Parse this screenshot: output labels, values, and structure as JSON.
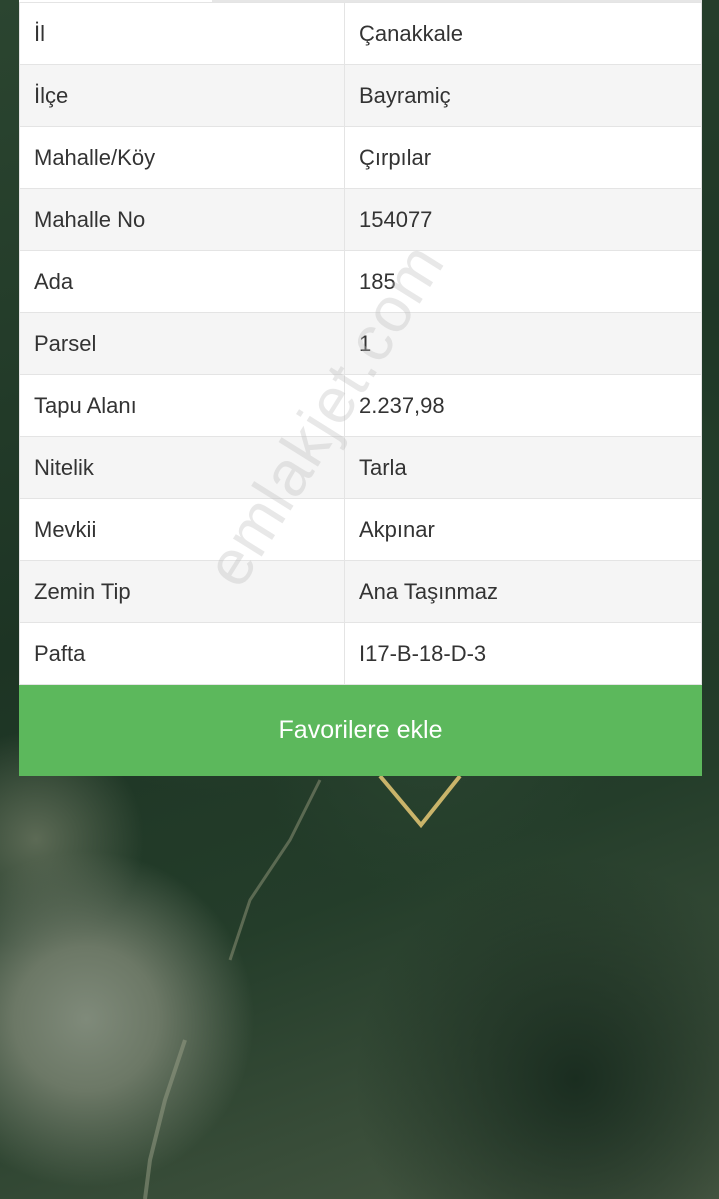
{
  "details": {
    "rows": [
      {
        "label": "İl",
        "value": "Çanakkale"
      },
      {
        "label": "İlçe",
        "value": "Bayramiç"
      },
      {
        "label": "Mahalle/Köy",
        "value": "Çırpılar"
      },
      {
        "label": "Mahalle No",
        "value": "154077"
      },
      {
        "label": "Ada",
        "value": "185"
      },
      {
        "label": "Parsel",
        "value": "1"
      },
      {
        "label": "Tapu Alanı",
        "value": "2.237,98"
      },
      {
        "label": "Nitelik",
        "value": "Tarla"
      },
      {
        "label": "Mevkii",
        "value": "Akpınar"
      },
      {
        "label": "Zemin Tip",
        "value": "Ana Taşınmaz"
      },
      {
        "label": "Pafta",
        "value": "I17-B-18-D-3"
      }
    ]
  },
  "actions": {
    "favorite_label": "Favorilere ekle"
  },
  "watermark": "emlakjet.com",
  "colors": {
    "button": "#5cb85c",
    "parcel_outline": "#c9b46a"
  }
}
